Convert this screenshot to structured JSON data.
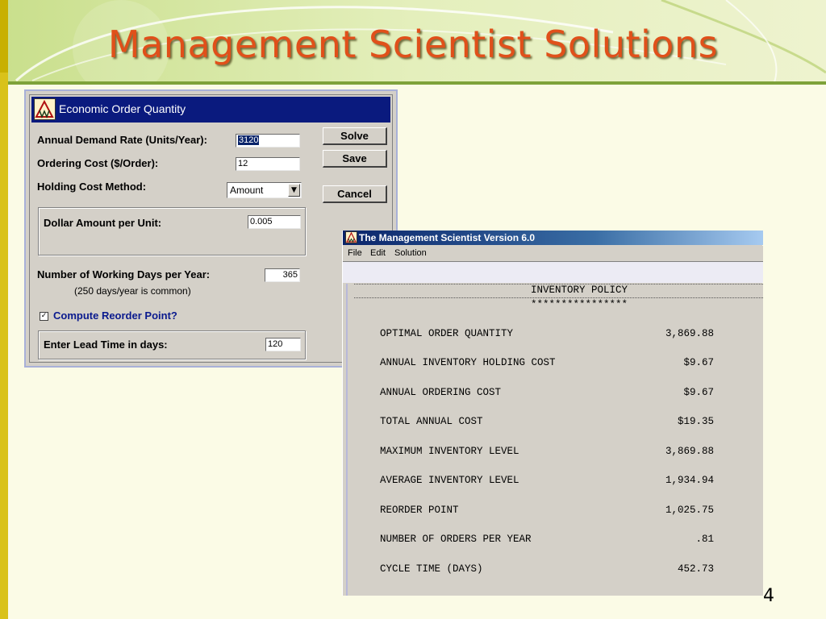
{
  "slide": {
    "title": "Management Scientist Solutions",
    "page_number": "4"
  },
  "eoq_window": {
    "title": "Economic Order Quantity",
    "fields": {
      "annual_demand_label": "Annual Demand Rate (Units/Year):",
      "annual_demand_value": "3120",
      "ordering_cost_label": "Ordering Cost ($/Order):",
      "ordering_cost_value": "12",
      "holding_method_label": "Holding Cost Method:",
      "holding_method_value": "Amount",
      "dollar_amount_label": "Dollar Amount per Unit:",
      "dollar_amount_value": "0.005",
      "working_days_label": "Number of Working Days per Year:",
      "working_days_value": "365",
      "working_days_note": "(250 days/year is common)",
      "reorder_checkbox_label": "Compute Reorder Point?",
      "reorder_checked": true,
      "lead_time_label": "Enter Lead Time in days:",
      "lead_time_value": "120"
    },
    "buttons": {
      "solve": "Solve",
      "save": "Save",
      "cancel": "Cancel"
    }
  },
  "ms_window": {
    "title": "The Management Scientist Version 6.0",
    "menu": [
      "File",
      "Edit",
      "Solution"
    ],
    "report": {
      "heading": "INVENTORY POLICY",
      "underline": "****************",
      "rows": [
        {
          "label": "OPTIMAL ORDER QUANTITY",
          "value": "3,869.88"
        },
        {
          "label": "ANNUAL INVENTORY HOLDING COST",
          "value": "$9.67"
        },
        {
          "label": "ANNUAL ORDERING COST",
          "value": "$9.67"
        },
        {
          "label": "TOTAL ANNUAL COST",
          "value": "$19.35"
        },
        {
          "label": "MAXIMUM INVENTORY LEVEL",
          "value": "3,869.88"
        },
        {
          "label": "AVERAGE INVENTORY LEVEL",
          "value": "1,934.94"
        },
        {
          "label": "REORDER POINT",
          "value": "1,025.75"
        },
        {
          "label": "NUMBER OF ORDERS PER YEAR",
          "value": ".81"
        },
        {
          "label": "CYCLE TIME (DAYS)",
          "value": "452.73"
        }
      ]
    }
  },
  "colors": {
    "title_orange": "#e0501a",
    "title_bar_navy": "#0a1a7e",
    "accent_green": "#7ea23a",
    "checkbox_label_blue": "#0a1a8e"
  }
}
